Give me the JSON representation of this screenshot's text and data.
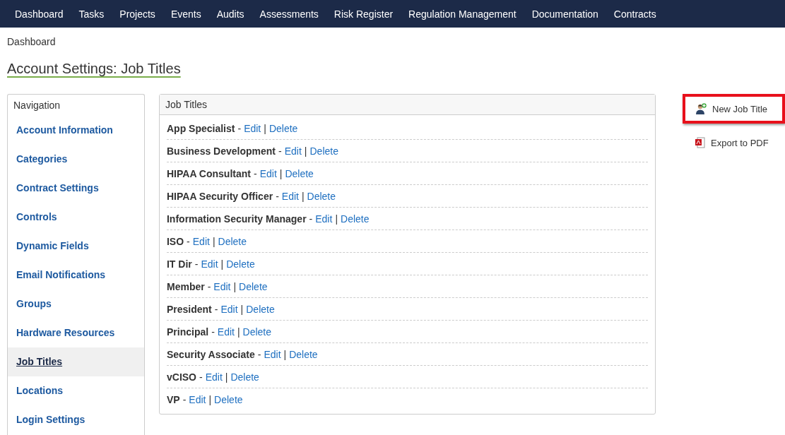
{
  "top_nav": [
    "Dashboard",
    "Tasks",
    "Projects",
    "Events",
    "Audits",
    "Assessments",
    "Risk Register",
    "Regulation Management",
    "Documentation",
    "Contracts"
  ],
  "breadcrumb": "Dashboard",
  "page_title": "Account Settings: Job Titles",
  "sidebar": {
    "title": "Navigation",
    "items": [
      {
        "label": "Account Information",
        "selected": false
      },
      {
        "label": "Categories",
        "selected": false
      },
      {
        "label": "Contract Settings",
        "selected": false
      },
      {
        "label": "Controls",
        "selected": false
      },
      {
        "label": "Dynamic Fields",
        "selected": false
      },
      {
        "label": "Email Notifications",
        "selected": false
      },
      {
        "label": "Groups",
        "selected": false
      },
      {
        "label": "Hardware Resources",
        "selected": false
      },
      {
        "label": "Job Titles",
        "selected": true
      },
      {
        "label": "Locations",
        "selected": false
      },
      {
        "label": "Login Settings",
        "selected": false
      }
    ]
  },
  "panel": {
    "title": "Job Titles",
    "rows": [
      {
        "name": "App Specialist",
        "dash": "-",
        "edit": "Edit",
        "bar": "|",
        "delete": "Delete"
      },
      {
        "name": "Business Development",
        "dash": "-",
        "edit": "Edit",
        "bar": "|",
        "delete": "Delete"
      },
      {
        "name": "HIPAA Consultant",
        "dash": "-",
        "edit": "Edit",
        "bar": "|",
        "delete": "Delete"
      },
      {
        "name": "HIPAA Security Officer",
        "dash": "-",
        "edit": "Edit",
        "bar": "|",
        "delete": "Delete"
      },
      {
        "name": "Information Security Manager",
        "dash": "-",
        "edit": "Edit",
        "bar": "|",
        "delete": "Delete"
      },
      {
        "name": "ISO",
        "dash": "-",
        "edit": "Edit",
        "bar": "|",
        "delete": "Delete"
      },
      {
        "name": "IT Dir",
        "dash": "-",
        "edit": "Edit",
        "bar": "|",
        "delete": "Delete"
      },
      {
        "name": "Member",
        "dash": "-",
        "edit": "Edit",
        "bar": "|",
        "delete": "Delete"
      },
      {
        "name": "President",
        "dash": "-",
        "edit": "Edit",
        "bar": "|",
        "delete": "Delete"
      },
      {
        "name": "Principal",
        "dash": "-",
        "edit": "Edit",
        "bar": "|",
        "delete": "Delete"
      },
      {
        "name": "Security Associate",
        "dash": "-",
        "edit": "Edit",
        "bar": "|",
        "delete": "Delete"
      },
      {
        "name": "vCISO",
        "dash": "-",
        "edit": "Edit",
        "bar": "|",
        "delete": "Delete"
      },
      {
        "name": "VP",
        "dash": "-",
        "edit": "Edit",
        "bar": "|",
        "delete": "Delete"
      }
    ]
  },
  "actions": [
    {
      "kind": "user",
      "label": "New Job Title",
      "highlighted": true
    },
    {
      "kind": "pdf",
      "label": "Export to PDF",
      "highlighted": false
    }
  ]
}
